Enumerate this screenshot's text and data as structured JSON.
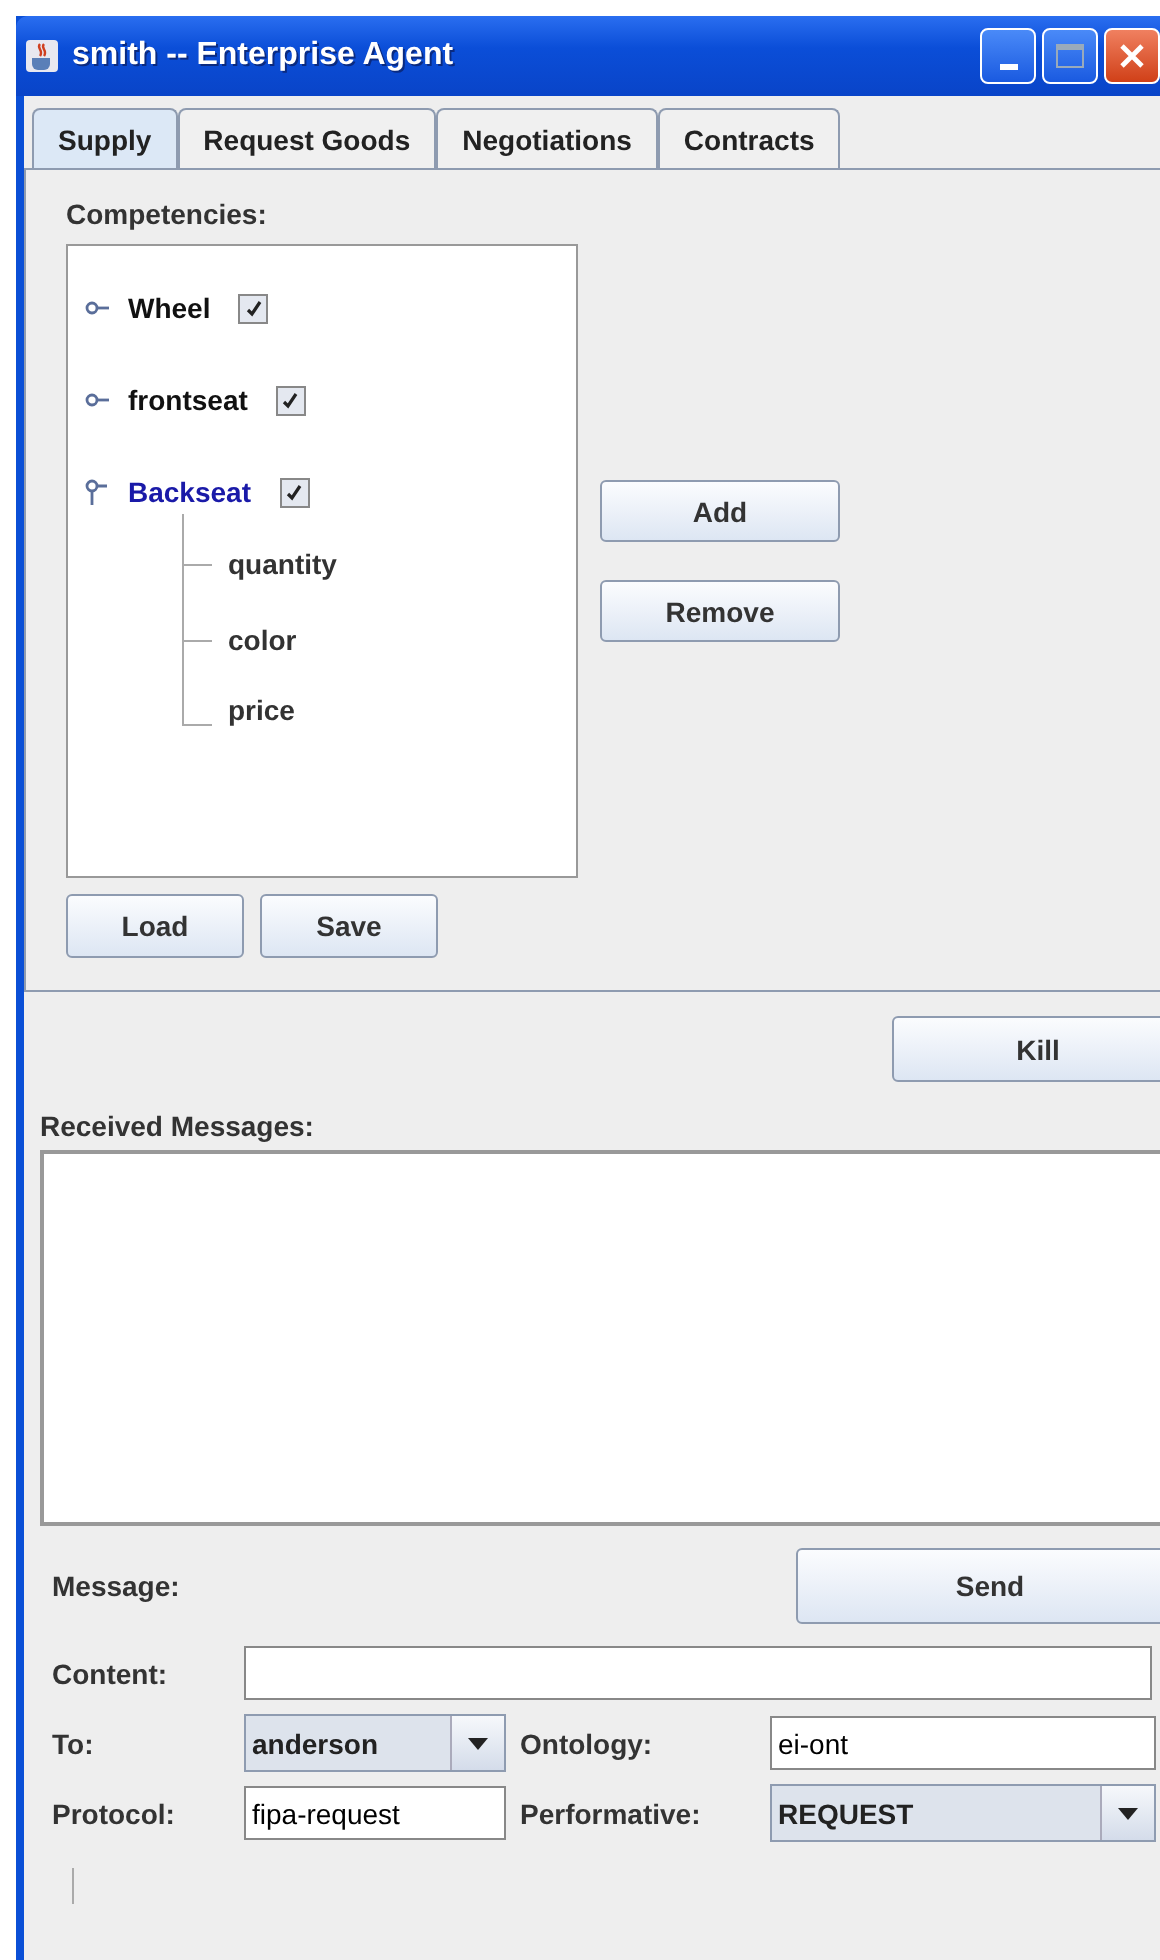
{
  "window": {
    "title": "smith -- Enterprise Agent"
  },
  "tabs": [
    {
      "label": "Supply",
      "selected": true
    },
    {
      "label": "Request Goods",
      "selected": false
    },
    {
      "label": "Negotiations",
      "selected": false
    },
    {
      "label": "Contracts",
      "selected": false
    }
  ],
  "competencies": {
    "label": "Competencies:",
    "tree": [
      {
        "label": "Wheel",
        "checked": true,
        "expanded": false,
        "selected": false
      },
      {
        "label": "frontseat",
        "checked": true,
        "expanded": false,
        "selected": false
      },
      {
        "label": "Backseat",
        "checked": true,
        "expanded": true,
        "selected": true,
        "children": [
          {
            "label": "quantity"
          },
          {
            "label": "color"
          },
          {
            "label": "price"
          }
        ]
      }
    ],
    "side_buttons": [
      "Add",
      "Remove"
    ],
    "bottom_buttons": [
      "Load",
      "Save"
    ]
  },
  "kill_button": "Kill",
  "received": {
    "label": "Received Messages:"
  },
  "message": {
    "label": "Message:",
    "send_button": "Send",
    "content": {
      "label": "Content:"
    },
    "to": {
      "label": "To:",
      "value": "anderson"
    },
    "ontology": {
      "label": "Ontology:",
      "value": "ei-ont"
    },
    "protocol": {
      "label": "Protocol:",
      "value": "fipa-request"
    },
    "performative": {
      "label": "Performative:",
      "value": "REQUEST"
    }
  }
}
